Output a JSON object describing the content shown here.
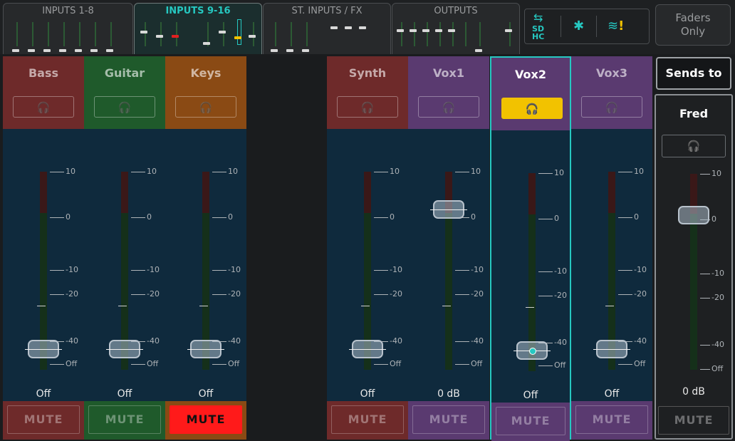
{
  "tabs": [
    {
      "label": "INPUTS 1-8"
    },
    {
      "label": "INPUTS 9-16"
    },
    {
      "label": "ST. INPUTS / FX"
    },
    {
      "label": "OUTPUTS"
    }
  ],
  "status_icons": {
    "usb": "usb-icon",
    "sd": "sd-card-icon",
    "bluetooth": "bluetooth-icon",
    "wifi": "wifi-warning-icon"
  },
  "faders_only_label": "Faders\nOnly",
  "sends_to_label": "Sends to",
  "scale": {
    "t10": "10",
    "t0": "0",
    "tm10": "-10",
    "tm20": "-20",
    "tm40": "-40",
    "off": "Off"
  },
  "colors": {
    "red": "#6e2a2a",
    "green": "#1f5a2b",
    "orange": "#8a4a14",
    "purple": "#5a3a70",
    "cyan": "#26c8c1",
    "pfl_active": "#f2c200",
    "mute_active": "#ff1a1a"
  },
  "strips": [
    {
      "name": "Bass",
      "value": "Off",
      "mute": "MUTE"
    },
    {
      "name": "Guitar",
      "value": "Off",
      "mute": "MUTE"
    },
    {
      "name": "Keys",
      "value": "Off",
      "mute": "MUTE"
    },
    {
      "name": "Synth",
      "value": "Off",
      "mute": "MUTE"
    },
    {
      "name": "Vox1",
      "value": "0 dB",
      "mute": "MUTE"
    },
    {
      "name": "Vox2",
      "value": "Off",
      "mute": "MUTE"
    },
    {
      "name": "Vox3",
      "value": "Off",
      "mute": "MUTE"
    }
  ],
  "master": {
    "name": "Fred",
    "value": "0 dB",
    "mute": "MUTE"
  }
}
